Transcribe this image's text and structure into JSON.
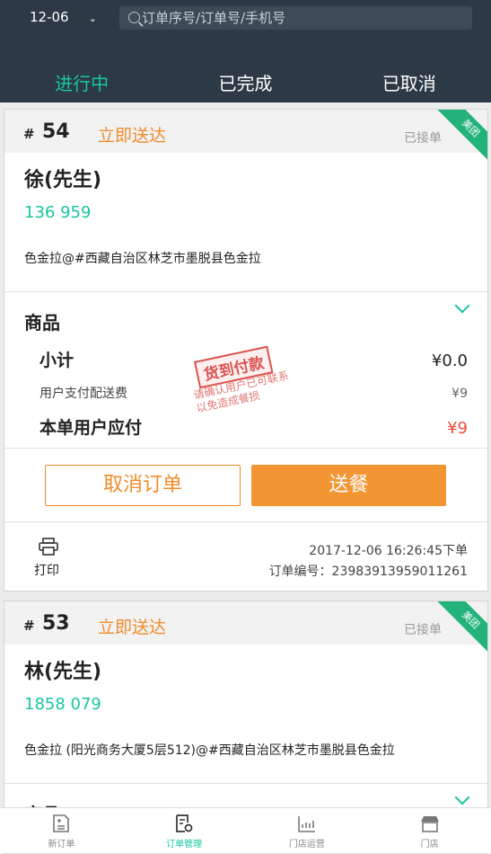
{
  "header": {
    "date": "12-06",
    "search_placeholder": "订单序号/订单号/手机号",
    "tabs": [
      {
        "label": "进行中",
        "active": true
      },
      {
        "label": "已完成",
        "active": false
      },
      {
        "label": "已取消",
        "active": false
      }
    ]
  },
  "orders": [
    {
      "num": "54",
      "delivery": "立即送达",
      "status": "已接单",
      "platform": "美团",
      "customer": "徐(先生)",
      "phone": "136      959",
      "address": "色金拉@#西藏自治区林芝市墨脱县色金拉",
      "goods_label": "商品",
      "subtotal_label": "小计",
      "subtotal": "¥0.0",
      "fee_label": "用户支付配送费",
      "fee": "¥9",
      "pay_label": "本单用户应付",
      "pay": "¥9",
      "stamp_title": "货到付款",
      "stamp_note": "请确认用户已可联系以免造成餐损",
      "cancel_label": "取消订单",
      "deliver_label": "送餐",
      "print_label": "打印",
      "time": "2017-12-06 16:26:45下单",
      "order_id": "订单编号：23983913959011261"
    },
    {
      "num": "53",
      "delivery": "立即送达",
      "status": "已接单",
      "platform": "美团",
      "customer": "林(先生)",
      "phone": "1858      079",
      "address": "色金拉 (阳光商务大厦5层512)@#西藏自治区林芝市墨脱县色金拉",
      "goods_label": "商品"
    }
  ],
  "nav": [
    {
      "label": "新订单",
      "icon": "new-order-icon",
      "active": false
    },
    {
      "label": "订单管理",
      "icon": "order-manage-icon",
      "active": true
    },
    {
      "label": "门店运营",
      "icon": "store-ops-icon",
      "active": false
    },
    {
      "label": "门店",
      "icon": "store-icon",
      "active": false
    }
  ],
  "colors": {
    "accent": "#19c6a0",
    "orange": "#f08c2a",
    "header": "#2d3a46",
    "price_red": "#f04a3a"
  }
}
